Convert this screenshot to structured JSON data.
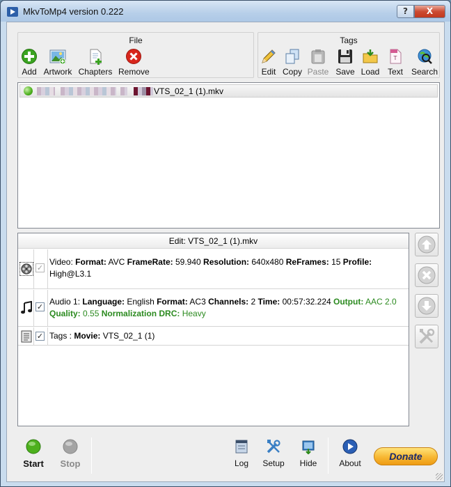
{
  "window": {
    "title": "MkvToMp4 version 0.222",
    "help_label": "?",
    "close_label": "X"
  },
  "toolbar": {
    "file_group": {
      "title": "File",
      "buttons": [
        {
          "label": "Add",
          "icon": "add-icon"
        },
        {
          "label": "Artwork",
          "icon": "artwork-icon"
        },
        {
          "label": "Chapters",
          "icon": "chapters-icon"
        },
        {
          "label": "Remove",
          "icon": "remove-icon"
        }
      ]
    },
    "tags_group": {
      "title": "Tags",
      "buttons": [
        {
          "label": "Edit",
          "icon": "pencil-icon"
        },
        {
          "label": "Copy",
          "icon": "copy-icon"
        },
        {
          "label": "Paste",
          "icon": "paste-icon",
          "disabled": true
        },
        {
          "label": "Save",
          "icon": "floppy-icon"
        },
        {
          "label": "Load",
          "icon": "load-icon"
        },
        {
          "label": "Text",
          "icon": "text-icon"
        },
        {
          "label": "Search",
          "icon": "search-icon"
        }
      ]
    }
  },
  "file_list": {
    "items": [
      {
        "status": "ready",
        "name": "VTS_02_1 (1).mkv"
      }
    ]
  },
  "edit_panel": {
    "header": "Edit: VTS_02_1 (1).mkv",
    "video": {
      "prefix": "Video: ",
      "format_label": "Format:",
      "format_value": " AVC ",
      "framerate_label": "FrameRate:",
      "framerate_value": " 59.940 ",
      "resolution_label": "Resolution:",
      "resolution_value": " 640x480 ",
      "reframes_label": "ReFrames:",
      "reframes_value": " 15 ",
      "profile_label": "Profile:",
      "profile_value": " High@L3.1",
      "checked": true
    },
    "audio": {
      "prefix": "Audio 1: ",
      "language_label": "Language:",
      "language_value": " English ",
      "format_label": "Format:",
      "format_value": " AC3 ",
      "channels_label": "Channels:",
      "channels_value": " 2 ",
      "time_label": "Time:",
      "time_value": " 00:57:32.224 ",
      "output_label": "Output:",
      "output_value": " AAC 2.0 ",
      "quality_label": "Quality:",
      "quality_value": " 0.55 ",
      "drc_label": "Normalization DRC:",
      "drc_value": " Heavy",
      "checked": true
    },
    "tags": {
      "prefix": "Tags : ",
      "movie_label": "Movie:",
      "movie_value": " VTS_02_1 (1)",
      "checked": true
    },
    "check_mark": "✓"
  },
  "side_buttons": [
    "move-up-icon",
    "delete-icon",
    "move-down-icon",
    "tools-icon"
  ],
  "bottom": {
    "start": "Start",
    "stop": "Stop",
    "log": "Log",
    "setup": "Setup",
    "hide": "Hide",
    "about": "About",
    "donate": "Donate"
  },
  "colors": {
    "accent_green": "#2b8a1f",
    "start_green": "#4db01d",
    "remove_red": "#d8261c",
    "donate_orange": "#f7b733"
  }
}
